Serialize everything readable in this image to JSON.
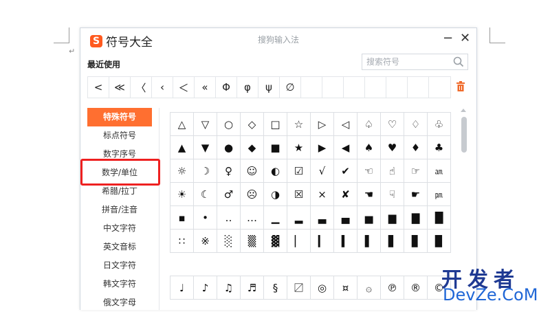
{
  "window": {
    "title": "符号大全",
    "app_name": "搜狗输入法",
    "logo_letter": "S",
    "minimize_symbol": "−",
    "close_symbol": "✕",
    "brand_color": "#ff5a1f"
  },
  "header": {
    "recent_label": "最近使用",
    "search_placeholder": "搜索符号"
  },
  "recent_symbols": [
    "<",
    "≪",
    "〈",
    "‹",
    "＜",
    "«",
    "Φ",
    "φ",
    "ψ",
    "∅",
    "",
    "",
    "",
    "",
    "",
    "",
    ""
  ],
  "sidebar": {
    "items": [
      {
        "label": "特殊符号",
        "active": true
      },
      {
        "label": "标点符号",
        "active": false
      },
      {
        "label": "数字序号",
        "active": false
      },
      {
        "label": "数学/单位",
        "active": false
      },
      {
        "label": "希腊/拉丁",
        "active": false
      },
      {
        "label": "拼音/注音",
        "active": false
      },
      {
        "label": "中文字符",
        "active": false
      },
      {
        "label": "英文音标",
        "active": false
      },
      {
        "label": "日文字符",
        "active": false
      },
      {
        "label": "韩文字符",
        "active": false
      },
      {
        "label": "俄文字母",
        "active": false
      }
    ]
  },
  "grid_main": [
    [
      "△",
      "▽",
      "○",
      "◇",
      "□",
      "☆",
      "▷",
      "◁",
      "♤",
      "♡",
      "♢",
      "♧"
    ],
    [
      "▲",
      "▼",
      "●",
      "◆",
      "■",
      "★",
      "▶",
      "◀",
      "♠",
      "♥",
      "♦",
      "♣"
    ],
    [
      "☼",
      "☽",
      "♀",
      "☺",
      "◐",
      "☑",
      "√",
      "✔",
      "☜",
      "☝",
      "☞",
      "㏂"
    ],
    [
      "☀",
      "☾",
      "♂",
      "☹",
      "◑",
      "☒",
      "×",
      "✘",
      "☚",
      "☟",
      "☛",
      "㏘"
    ],
    [
      "▪",
      "•",
      "‥",
      "…",
      "▁",
      "▂",
      "▃",
      "▄",
      "▅",
      "▆",
      "▇",
      "█"
    ],
    [
      "∷",
      "※",
      "░",
      "▒",
      "▓",
      "▏",
      "▎",
      "▍",
      "▌",
      "▋",
      "▊",
      "▉"
    ]
  ],
  "grid_second": [
    [
      "♩",
      "♪",
      "♫",
      "♬",
      "§",
      "〼",
      "◎",
      "¤",
      "۞",
      "℗",
      "®",
      "©"
    ]
  ],
  "watermark": {
    "cn": "开发者",
    "en": "DevZe.CoM"
  }
}
